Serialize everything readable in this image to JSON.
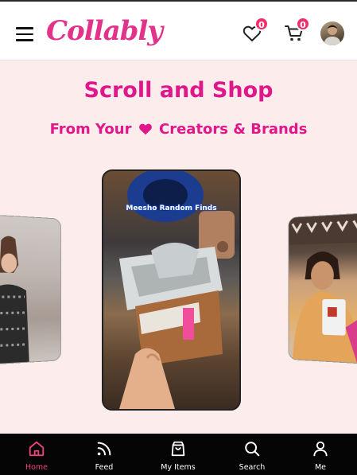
{
  "header": {
    "logo": "Collably",
    "wishlist_count": "0",
    "cart_count": "0"
  },
  "hero": {
    "title": "Scroll and Shop",
    "subtitle_before": "From Your",
    "subtitle_after": "Creators & Brands"
  },
  "carousel": {
    "center_caption": "Meesho Random Finds"
  },
  "nav": {
    "items": [
      {
        "label": "Home",
        "icon": "home-icon",
        "active": true
      },
      {
        "label": "Feed",
        "icon": "rss-icon"
      },
      {
        "label": "My Items",
        "icon": "shopping-bag-icon"
      },
      {
        "label": "Search",
        "icon": "search-icon"
      },
      {
        "label": "Me",
        "icon": "user-icon"
      }
    ]
  },
  "colors": {
    "brand_pink": "#e0168b",
    "badge": "#f0306e",
    "background": "#fdecec",
    "nav_bg": "#050505"
  }
}
